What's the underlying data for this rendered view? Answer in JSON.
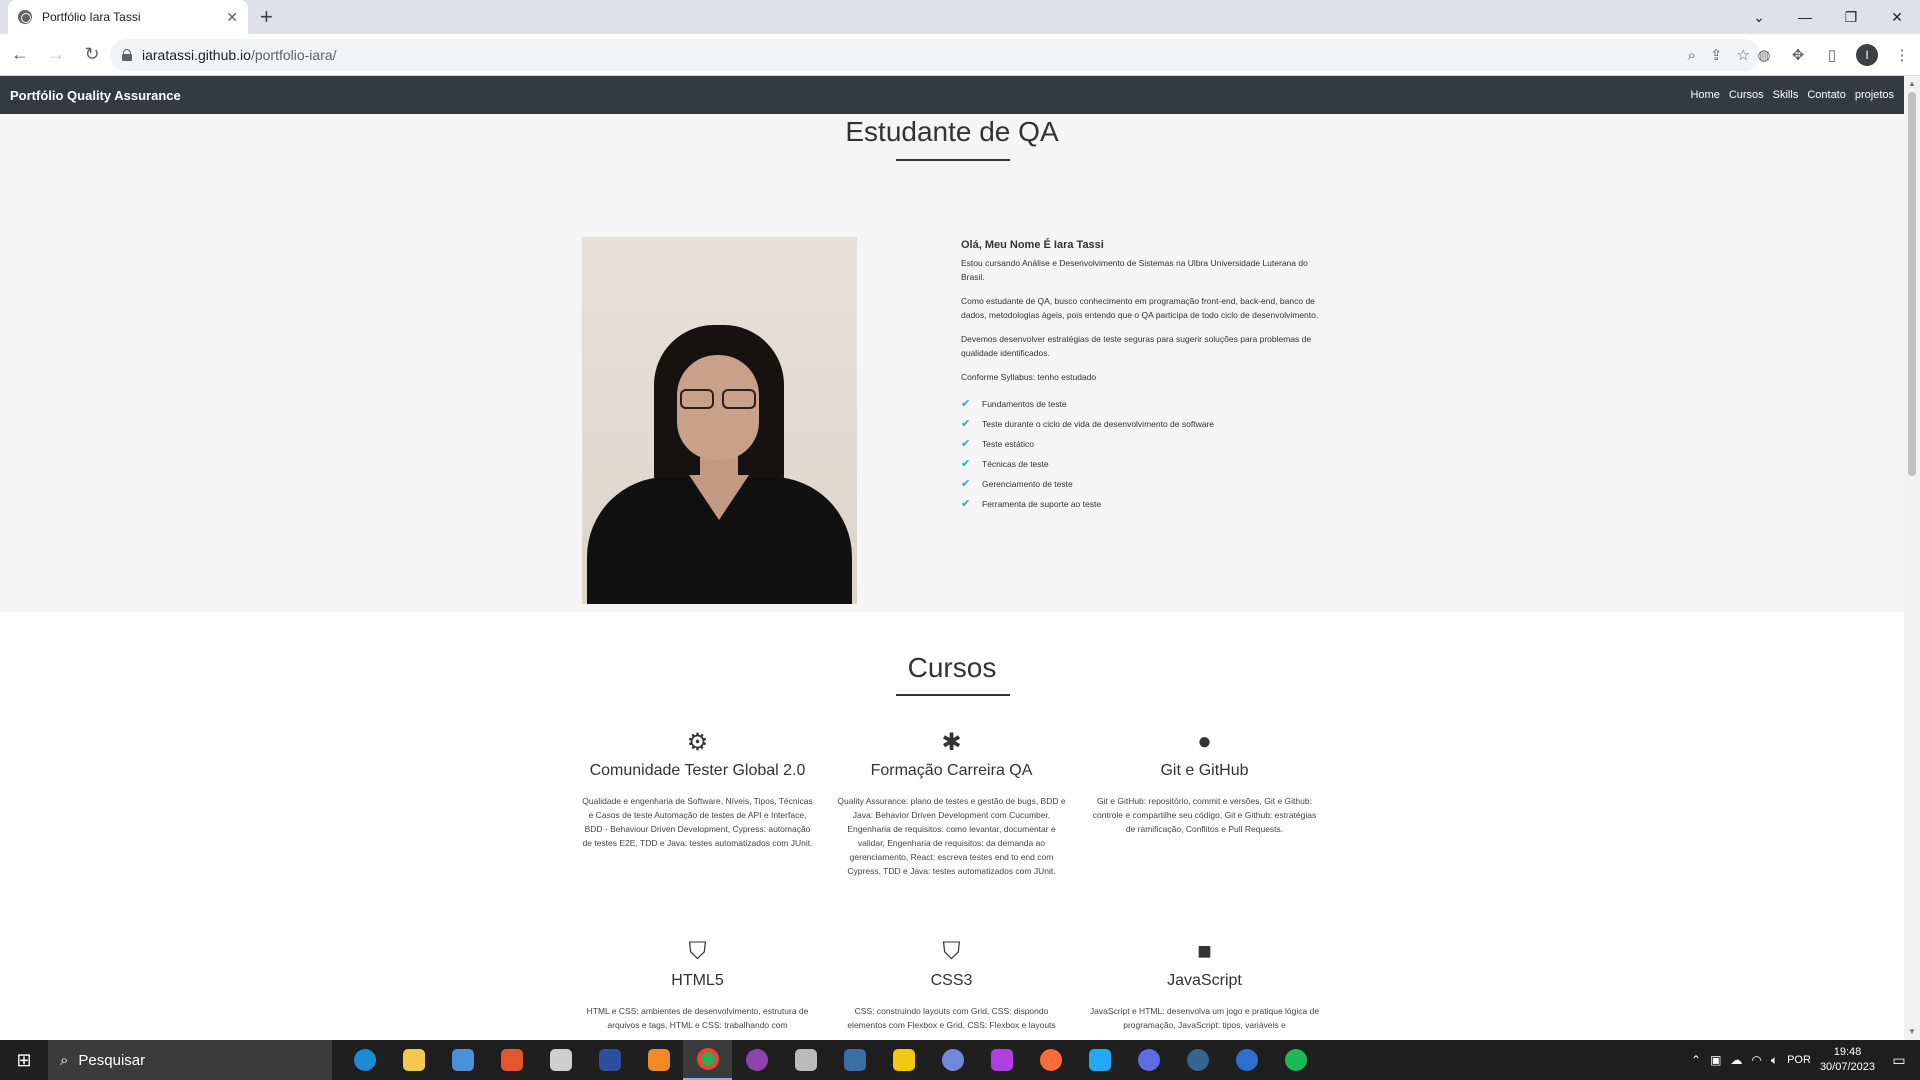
{
  "browser": {
    "tab_title": "Portfólio Iara Tassi",
    "url_domain": "iaratassi.github.io",
    "url_path": "/portfolio-iara/",
    "avatar_letter": "I"
  },
  "site": {
    "brand": "Portfólio Quality Assurance",
    "nav": [
      "Home",
      "Cursos",
      "Skills",
      "Contato",
      "projetos"
    ],
    "about": {
      "title": "Estudante de QA",
      "name": "Olá, Meu Nome É Iara Tassi",
      "p1": "Estou cursando Análise e Desenvolvimento de Sistemas na Ulbra Universidade Luterana do Brasil.",
      "p2": "Como estudante de QA, busco conhecimento em programação front-end, back-end, banco de dados, metodologias ágeis, pois entendo que o QA participa de todo ciclo de desenvolvimento.",
      "p3": "Devemos desenvolver estratégias de teste seguras para sugerir soluções para problemas de qualidade identificados.",
      "p4": "Conforme Syllabus: tenho estudado",
      "list": [
        "Fundamentos de teste",
        "Teste durante o ciclo de vida de desenvolvimento de software",
        "Teste estático",
        "Técnicas de teste",
        "Gerenciamento de teste",
        "Ferramenta de suporte ao teste"
      ]
    },
    "courses": {
      "title": "Cursos",
      "items": [
        {
          "icon": "users-cog-icon",
          "title": "Comunidade Tester Global 2.0",
          "desc": "Qualidade e engenharia de Software, Níveis, Tipos, Técnicas e Casos de teste Automação de testes de API e Interface, BDD - Behaviour Driven Development, Cypress: automação de testes E2E, TDD e Java: testes automatizados com JUnit."
        },
        {
          "icon": "bug-icon",
          "title": "Formação Carreira QA",
          "desc": "Quality Assurance: plano de testes e gestão de bugs, BDD e Java: Behavior Driven Development com Cucumber, Engenharia de requisitos: como levantar, documentar e validar, Engenharia de requisitos: da demanda ao gerenciamento, React: escreva testes end to end com Cypress, TDD e Java: testes automatizados com JUnit."
        },
        {
          "icon": "github-icon",
          "title": "Git e GitHub",
          "desc": "Git e GitHub: repositório, commit e versões, Git e Github: controle e compartilhe seu código, Git e Github: estratégias de ramificação, Conflitos e Pull Requests."
        },
        {
          "icon": "html5-icon",
          "title": "HTML5",
          "desc": "HTML e CSS: ambientes de desenvolvimento, estrutura de arquivos e tags, HTML e CSS: trabalhando com"
        },
        {
          "icon": "css3-icon",
          "title": "CSS3",
          "desc": "CSS: construindo layouts com Grid, CSS: dispondo elementos com Flexbox e Grid, CSS: Flexbox e layouts"
        },
        {
          "icon": "javascript-icon",
          "title": "JavaScript",
          "desc": "JavaScript e HTML: desenvolva um jogo e pratique lógica de programação, JavaScript: tipos, variáveis e"
        }
      ]
    }
  },
  "taskbar": {
    "search_placeholder": "Pesquisar",
    "language": "POR",
    "time": "19:48",
    "date": "30/07/2023"
  }
}
